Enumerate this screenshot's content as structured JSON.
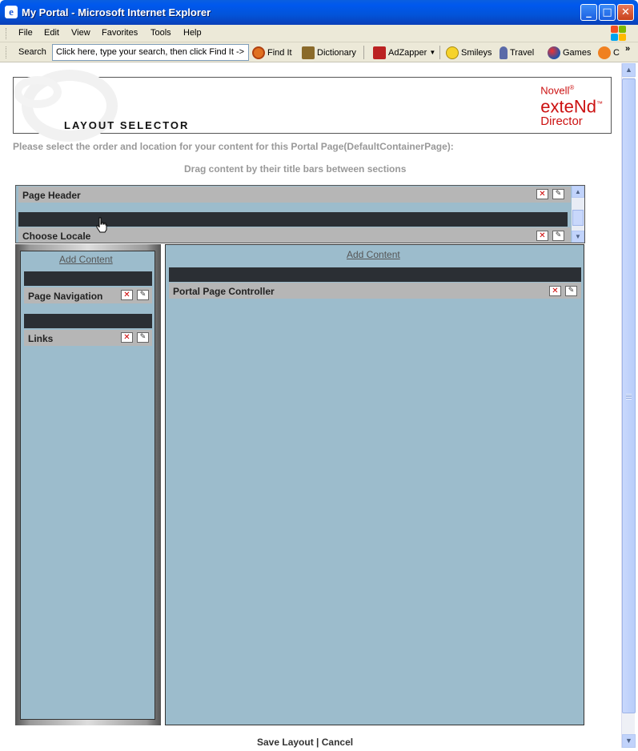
{
  "window": {
    "title": "My Portal - Microsoft Internet Explorer"
  },
  "menu": [
    "File",
    "Edit",
    "View",
    "Favorites",
    "Tools",
    "Help"
  ],
  "toolbar": {
    "search_label": "Search",
    "search_value": "Click here, type your search, then click Find It ->",
    "buttons": [
      "Find It",
      "Dictionary",
      "AdZapper",
      "Smileys",
      "Travel",
      "Games",
      "C"
    ],
    "overflow": "»"
  },
  "banner": {
    "title": "LAYOUT SELECTOR",
    "logo_line1": "Novell",
    "logo_line1_mark": "®",
    "logo_line2": "exteNd",
    "logo_line2_mark": "™",
    "logo_line3": "Director"
  },
  "instructions": {
    "line1": "Please select the order and location for your content for this Portal Page(DefaultContainerPage):",
    "line2": "Drag content by their title bars between sections"
  },
  "sections": {
    "header": {
      "portlets": [
        "Page Header",
        "Choose Locale"
      ]
    },
    "left": {
      "add_content": "Add Content",
      "portlets": [
        "Page Navigation",
        "Links"
      ]
    },
    "right": {
      "add_content": "Add Content",
      "portlets": [
        "Portal Page Controller"
      ]
    }
  },
  "footer": {
    "save": "Save Layout",
    "separator": "|",
    "cancel": "Cancel"
  },
  "icons": {
    "delete": "delete-icon",
    "edit": "edit-pencil-icon"
  },
  "colors": {
    "section_bg": "#9cbccc",
    "titlebar": "#0058ee",
    "drop_bar": "#2b2f34",
    "portlet_bar": "#b6b6b6"
  }
}
